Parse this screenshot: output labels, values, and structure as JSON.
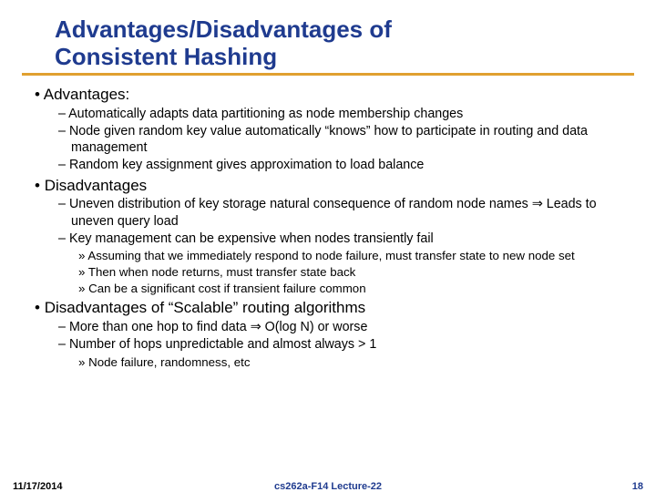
{
  "title_line1": "Advantages/Disadvantages of",
  "title_line2": "Consistent Hashing",
  "sections": {
    "adv_heading": "Advantages:",
    "adv_items": [
      "Automatically adapts data partitioning as node membership changes",
      "Node given random key value automatically “knows” how to participate in routing and data management",
      "Random key assignment gives approximation to load balance"
    ],
    "dis_heading": "Disadvantages",
    "dis_items": [
      "Uneven distribution of key storage natural consequence of random node names ⇒ Leads to uneven query load",
      "Key management can be expensive when nodes transiently fail"
    ],
    "dis_sub": [
      "Assuming that we immediately respond to node failure, must transfer state to new node set",
      "Then when node returns, must transfer state back",
      "Can be a significant cost if transient failure common"
    ],
    "scal_heading": "Disadvantages of “Scalable” routing algorithms",
    "scal_items": [
      "More than one hop to find data ⇒ O(log N) or worse",
      "Number of hops unpredictable and almost always > 1"
    ],
    "scal_sub": [
      "Node failure, randomness, etc"
    ]
  },
  "footer": {
    "date": "11/17/2014",
    "center": "cs262a-F14 Lecture-22",
    "page": "18"
  }
}
